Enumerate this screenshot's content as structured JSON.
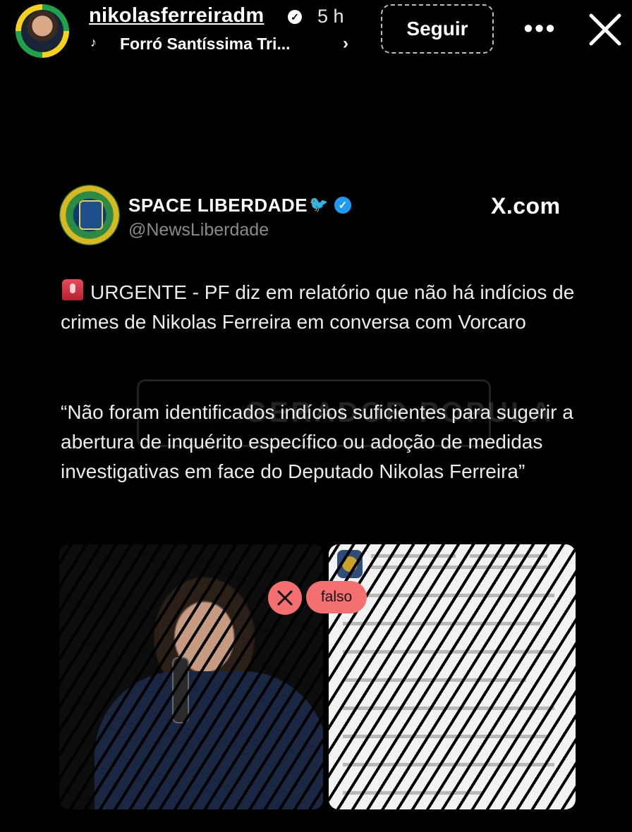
{
  "story": {
    "username": "nikolasferreiradm",
    "time": "5 h",
    "music_icon": "♪",
    "music_title": "Forró Santíssima Tri...",
    "music_chevron": "›",
    "follow_label": "Seguir",
    "more_label": "•••"
  },
  "tweet": {
    "display_name": "SPACE LIBERDADE",
    "handle": "@NewsLiberdade",
    "source": "X.com",
    "body_line1": "URGENTE - PF diz em relatório que não há indícios de crimes de Nikolas Ferreira em conversa com Vorcaro",
    "body_quote": "“Não foram identificados indícios suficientes para sugerir a abertura de inquérito específico ou adoção de medidas investigativas em face do Deputado Nikolas Ferreira”",
    "watermark": "GERADOR POPULA"
  },
  "fact_check": {
    "label": "falso",
    "color": "#f46f6f"
  },
  "icons": {
    "verified": "verified-icon",
    "close": "close-icon",
    "alert": "siren-icon",
    "bird": "bird-icon"
  }
}
